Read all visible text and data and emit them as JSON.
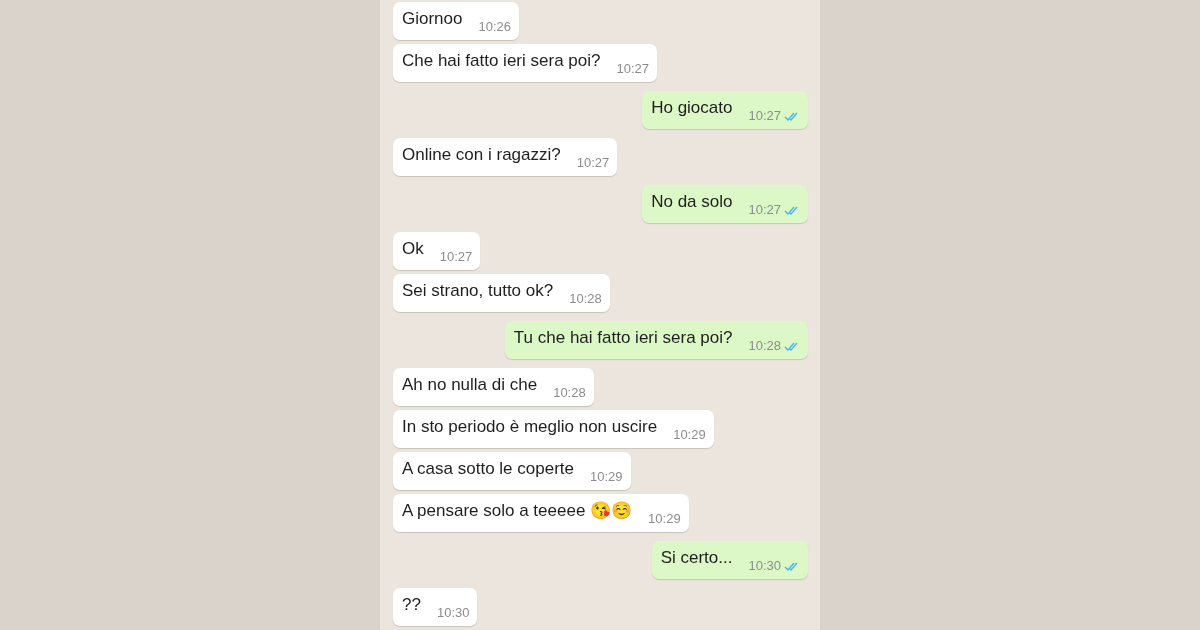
{
  "messages": [
    {
      "kind": "in",
      "text": "Giornoo",
      "time": "10:26"
    },
    {
      "kind": "in",
      "text": "Che hai fatto ieri sera poi?",
      "time": "10:27"
    },
    {
      "kind": "out",
      "text": "Ho giocato",
      "time": "10:27",
      "read": true
    },
    {
      "kind": "in",
      "text": "Online con i ragazzi?",
      "time": "10:27"
    },
    {
      "kind": "out",
      "text": "No da solo",
      "time": "10:27",
      "read": true
    },
    {
      "kind": "in",
      "text": "Ok",
      "time": "10:27"
    },
    {
      "kind": "in",
      "text": "Sei strano, tutto ok?",
      "time": "10:28"
    },
    {
      "kind": "out",
      "text": "Tu che hai fatto ieri sera poi?",
      "time": "10:28",
      "read": true
    },
    {
      "kind": "in",
      "text": "Ah no nulla di che",
      "time": "10:28"
    },
    {
      "kind": "in",
      "text": "In sto periodo è meglio non uscire",
      "time": "10:29"
    },
    {
      "kind": "in",
      "text": "A casa sotto le coperte",
      "time": "10:29"
    },
    {
      "kind": "in",
      "text": "A pensare solo a teeeee 😘☺️",
      "time": "10:29"
    },
    {
      "kind": "out",
      "text": "Si certo...",
      "time": "10:30",
      "read": true
    },
    {
      "kind": "in",
      "text": "??",
      "time": "10:30"
    }
  ]
}
